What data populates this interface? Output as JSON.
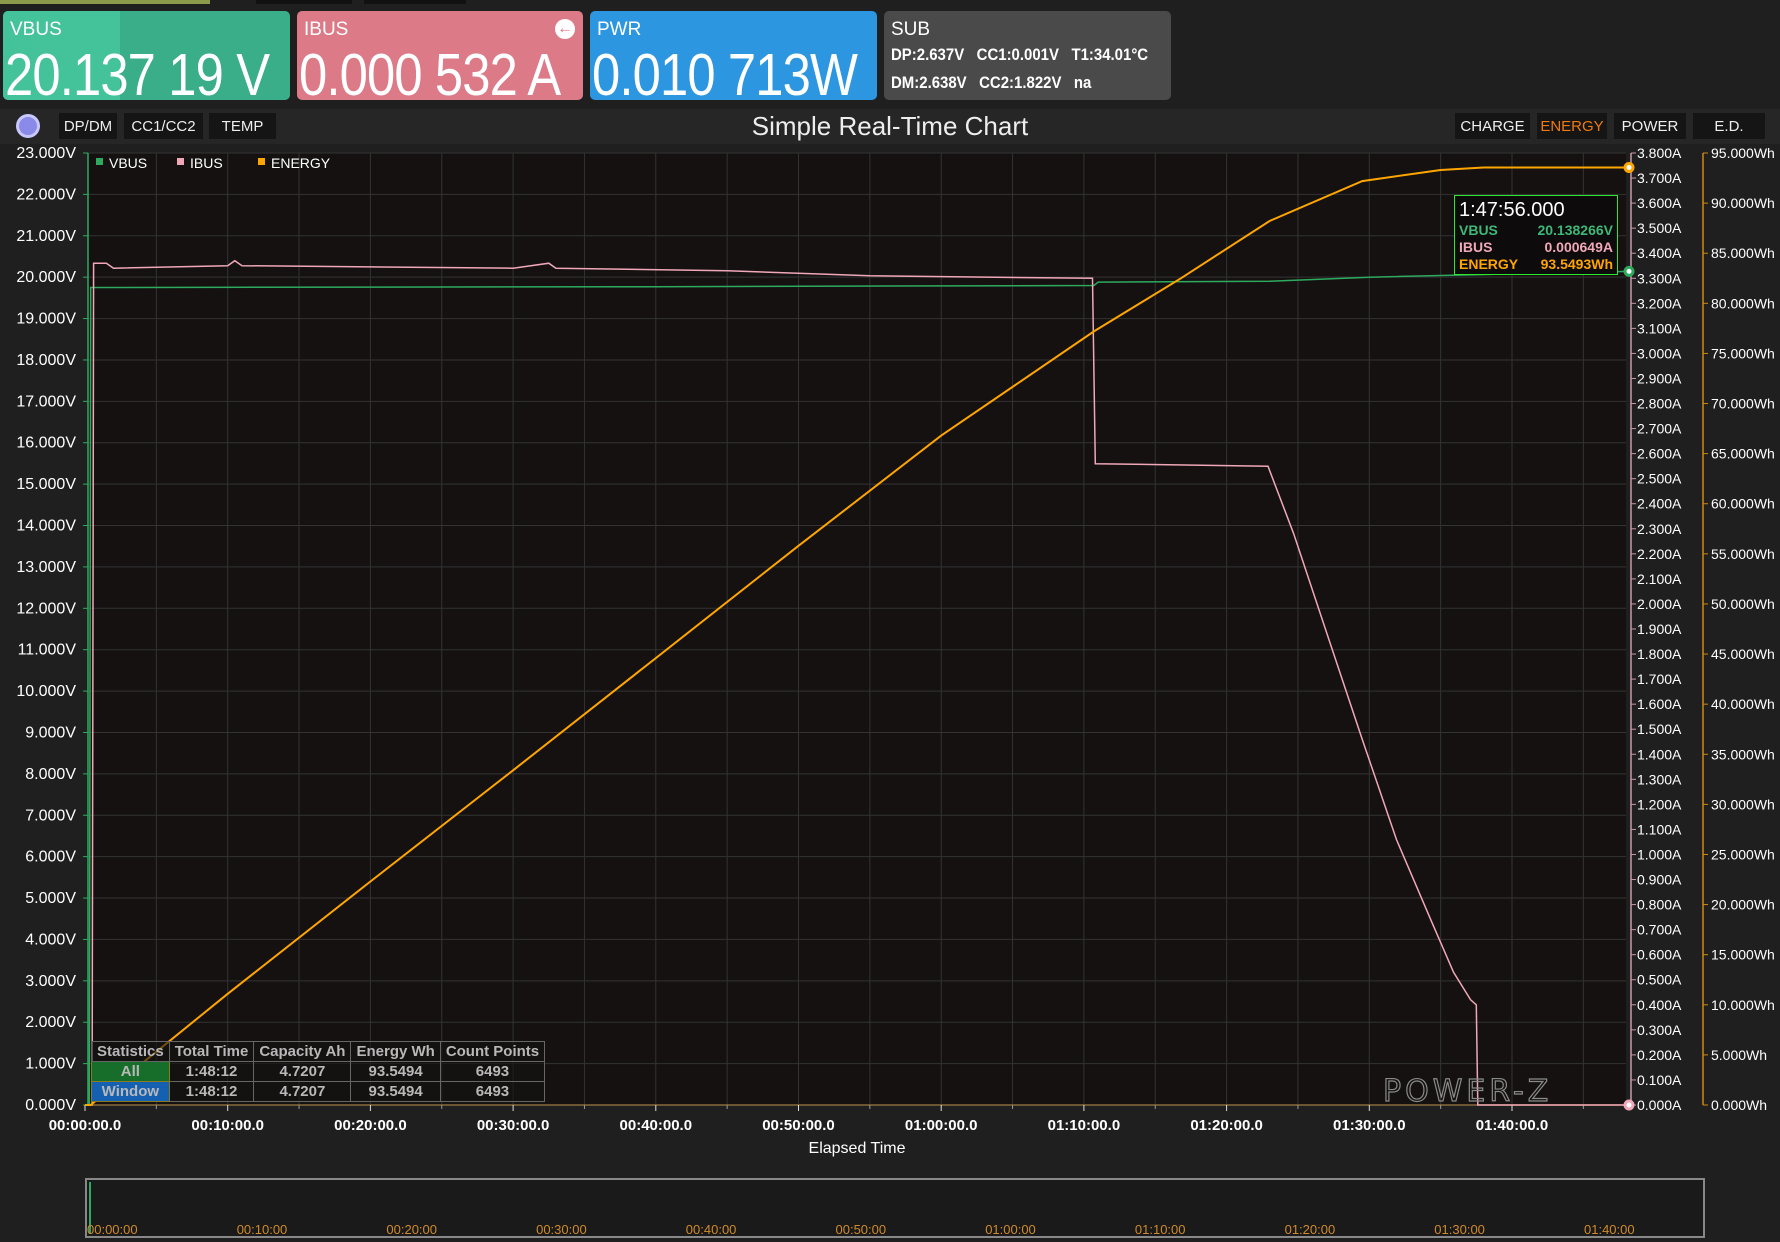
{
  "cards": {
    "vbus": {
      "label": "VBUS",
      "value": "20.137 19 V",
      "color": "#3db38c"
    },
    "ibus": {
      "label": "IBUS",
      "value": "0.000 532 A",
      "color": "#dc7a88",
      "icon": "arrow-left-circle-icon"
    },
    "pwr": {
      "label": "PWR",
      "value": "0.010 713W",
      "color": "#2d96e0"
    },
    "sub": {
      "label": "SUB",
      "line1": "DP:2.637V   CC1:0.001V   T1:34.01°C",
      "line2": "DM:2.638V   CC2:1.822V   na",
      "color": "#4a4a4a"
    }
  },
  "toolbar": {
    "left_tabs": [
      "DP/DM",
      "CC1/CC2",
      "TEMP"
    ],
    "title": "Simple Real-Time Chart",
    "right_tabs": [
      "CHARGE",
      "ENERGY",
      "POWER",
      "E.D."
    ],
    "active_right": "ENERGY"
  },
  "legend": [
    {
      "name": "VBUS",
      "color": "#2eaa5e"
    },
    {
      "name": "IBUS",
      "color": "#f0a8b8"
    },
    {
      "name": "ENERGY",
      "color": "#ffa500"
    }
  ],
  "tooltip": {
    "time": "1:47:56.000",
    "rows": [
      {
        "name": "VBUS",
        "value": "20.138266V",
        "color": "#3cb878"
      },
      {
        "name": "IBUS",
        "value": "0.000649A",
        "color": "#f0a8b8"
      },
      {
        "name": "ENERGY",
        "value": "93.5493Wh",
        "color": "#ffa500"
      }
    ]
  },
  "stats": {
    "headers": [
      "Statistics",
      "Total Time",
      "Capacity Ah",
      "Energy Wh",
      "Count Points"
    ],
    "rows": [
      [
        "All",
        "1:48:12",
        "4.7207",
        "93.5494",
        "6493"
      ],
      [
        "Window",
        "1:48:12",
        "4.7207",
        "93.5494",
        "6493"
      ]
    ]
  },
  "logo": "POWER-Z",
  "navigator_labels": [
    "00:00:00",
    "00:10:00",
    "00:20:00",
    "00:30:00",
    "00:40:00",
    "00:50:00",
    "01:00:00",
    "01:10:00",
    "01:20:00",
    "01:30:00",
    "01:40:00"
  ],
  "chart_data": {
    "type": "line",
    "title": "Simple Real-Time Chart",
    "xlabel": "Elapsed Time",
    "grid": true,
    "legend_placement": "top-left",
    "x_unit": "minutes",
    "xlim": [
      0,
      108.2
    ],
    "x_ticks": [
      "00:00:00.0",
      "00:10:00.0",
      "00:20:00.0",
      "00:30:00.0",
      "00:40:00.0",
      "00:50:00.0",
      "01:00:00.0",
      "01:10:00.0",
      "01:20:00.0",
      "01:30:00.0",
      "01:40:00.0"
    ],
    "axes": {
      "left": {
        "unit": "V",
        "ylim": [
          0,
          23
        ],
        "ticks": [
          "0.000V",
          "1.000V",
          "2.000V",
          "3.000V",
          "4.000V",
          "5.000V",
          "6.000V",
          "7.000V",
          "8.000V",
          "9.000V",
          "10.000V",
          "11.000V",
          "12.000V",
          "13.000V",
          "14.000V",
          "15.000V",
          "16.000V",
          "17.000V",
          "18.000V",
          "19.000V",
          "20.000V",
          "21.000V",
          "22.000V",
          "23.000V"
        ]
      },
      "right1": {
        "unit": "A",
        "ylim": [
          0,
          3.8
        ],
        "ticks": [
          "0.000A",
          "0.100A",
          "0.200A",
          "0.300A",
          "0.400A",
          "0.500A",
          "0.600A",
          "0.700A",
          "0.800A",
          "0.900A",
          "1.000A",
          "1.100A",
          "1.200A",
          "1.300A",
          "1.400A",
          "1.500A",
          "1.600A",
          "1.700A",
          "1.800A",
          "1.900A",
          "2.000A",
          "2.100A",
          "2.200A",
          "2.300A",
          "2.400A",
          "2.500A",
          "2.600A",
          "2.700A",
          "2.800A",
          "2.900A",
          "3.000A",
          "3.100A",
          "3.200A",
          "3.300A",
          "3.400A",
          "3.500A",
          "3.600A",
          "3.700A",
          "3.800A"
        ]
      },
      "right2": {
        "unit": "Wh",
        "ylim": [
          0,
          95
        ],
        "ticks": [
          "0.000Wh",
          "5.000Wh",
          "10.000Wh",
          "15.000Wh",
          "20.000Wh",
          "25.000Wh",
          "30.000Wh",
          "35.000Wh",
          "40.000Wh",
          "45.000Wh",
          "50.000Wh",
          "55.000Wh",
          "60.000Wh",
          "65.000Wh",
          "70.000Wh",
          "75.000Wh",
          "80.000Wh",
          "85.000Wh",
          "90.000Wh",
          "95.000Wh"
        ]
      }
    },
    "series": [
      {
        "name": "VBUS",
        "axis": "left",
        "color": "#2eaa5e",
        "points": [
          [
            0,
            0
          ],
          [
            0.3,
            0
          ],
          [
            0.4,
            19.75
          ],
          [
            20,
            19.76
          ],
          [
            40,
            19.77
          ],
          [
            70.7,
            19.8
          ],
          [
            71,
            19.88
          ],
          [
            83,
            19.9
          ],
          [
            90,
            20.0
          ],
          [
            100,
            20.08
          ],
          [
            108.2,
            20.14
          ]
        ]
      },
      {
        "name": "IBUS",
        "axis": "right1",
        "color": "#f0a8b8",
        "points": [
          [
            0,
            0
          ],
          [
            0.5,
            0
          ],
          [
            0.6,
            3.36
          ],
          [
            1.5,
            3.36
          ],
          [
            2,
            3.34
          ],
          [
            10,
            3.35
          ],
          [
            10.5,
            3.37
          ],
          [
            11,
            3.35
          ],
          [
            30,
            3.34
          ],
          [
            32.5,
            3.36
          ],
          [
            33,
            3.34
          ],
          [
            45,
            3.33
          ],
          [
            55,
            3.31
          ],
          [
            70.6,
            3.3
          ],
          [
            70.8,
            2.56
          ],
          [
            82.9,
            2.55
          ],
          [
            84.7,
            2.28
          ],
          [
            87.1,
            1.87
          ],
          [
            89.5,
            1.46
          ],
          [
            91.9,
            1.06
          ],
          [
            94.3,
            0.74
          ],
          [
            95.9,
            0.53
          ],
          [
            97.1,
            0.42
          ],
          [
            97.5,
            0.4
          ],
          [
            97.6,
            0
          ],
          [
            108.2,
            0
          ]
        ]
      },
      {
        "name": "ENERGY",
        "axis": "right2",
        "color": "#ffa500",
        "points": [
          [
            0,
            0
          ],
          [
            0.4,
            0
          ],
          [
            10,
            11.1
          ],
          [
            20,
            22.3
          ],
          [
            30,
            33.4
          ],
          [
            40,
            44.6
          ],
          [
            50,
            55.8
          ],
          [
            60,
            66.8
          ],
          [
            70.7,
            77.2
          ],
          [
            76.8,
            82.5
          ],
          [
            83,
            88.2
          ],
          [
            89.5,
            92.2
          ],
          [
            95,
            93.3
          ],
          [
            98,
            93.55
          ],
          [
            108.2,
            93.55
          ]
        ]
      }
    ]
  }
}
